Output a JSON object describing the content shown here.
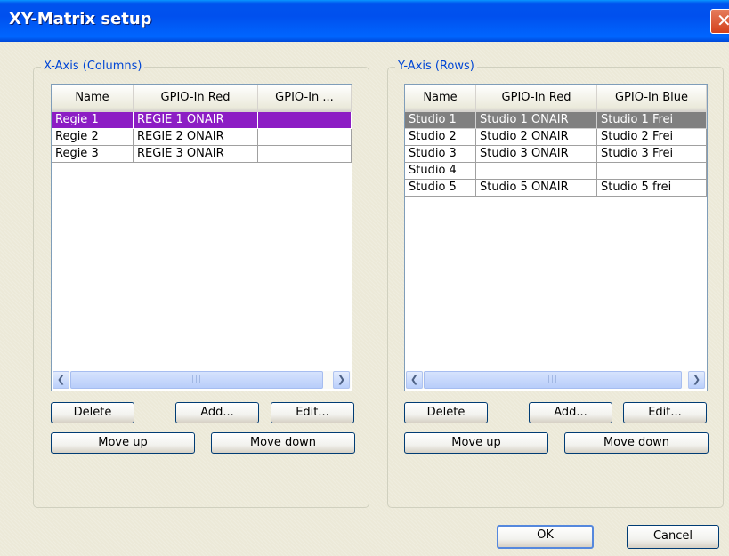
{
  "window": {
    "title": "XY-Matrix setup",
    "close_glyph": "✕"
  },
  "x_axis": {
    "title": "X-Axis (Columns)",
    "columns": [
      "Name",
      "GPIO-In Red",
      "GPIO-In ..."
    ],
    "rows": [
      [
        "Regie 1",
        "REGIE 1 ONAIR",
        ""
      ],
      [
        "Regie 2",
        "REGIE 2 ONAIR",
        ""
      ],
      [
        "Regie 3",
        "REGIE 3 ONAIR",
        ""
      ]
    ],
    "selected_row": 0,
    "buttons": {
      "delete": "Delete",
      "add": "Add...",
      "edit": "Edit...",
      "move_up": "Move up",
      "move_down": "Move down"
    },
    "scroll_left": "❮",
    "scroll_right": "❯",
    "scroll_grip": "|||"
  },
  "y_axis": {
    "title": "Y-Axis (Rows)",
    "columns": [
      "Name",
      "GPIO-In Red",
      "GPIO-In Blue"
    ],
    "rows": [
      [
        "Studio 1",
        "Studio 1 ONAIR",
        "Studio 1 Frei"
      ],
      [
        "Studio 2",
        "Studio 2 ONAIR",
        "Studio 2 Frei"
      ],
      [
        "Studio 3",
        "Studio 3 ONAIR",
        "Studio 3 Frei"
      ],
      [
        "Studio 4",
        "",
        ""
      ],
      [
        "Studio 5",
        "Studio 5 ONAIR",
        "Studio 5 frei"
      ]
    ],
    "selected_row": 0,
    "buttons": {
      "delete": "Delete",
      "add": "Add...",
      "edit": "Edit...",
      "move_up": "Move up",
      "move_down": "Move down"
    },
    "scroll_left": "❮",
    "scroll_right": "❯",
    "scroll_grip": "|||"
  },
  "dialog_buttons": {
    "ok": "OK",
    "cancel": "Cancel"
  },
  "colors": {
    "titlebar": "#0054e3",
    "x_selection": "#8c1dc4",
    "y_selection": "#808080",
    "group_title": "#0046d5"
  }
}
